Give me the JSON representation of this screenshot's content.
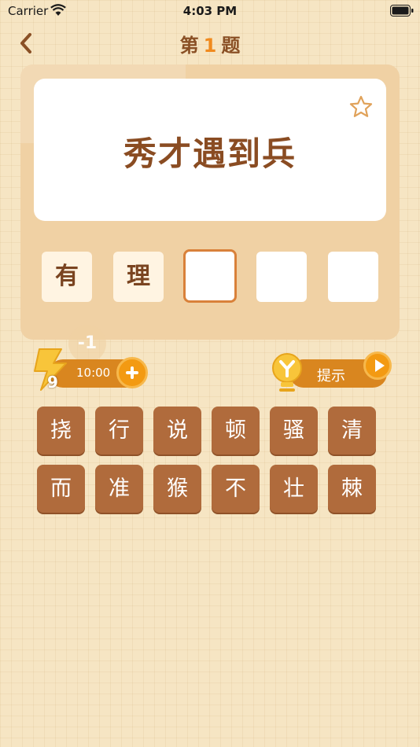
{
  "status": {
    "carrier": "Carrier",
    "time": "4:03 PM"
  },
  "header": {
    "title_prefix": "第",
    "question_number": "1",
    "title_suffix": "题"
  },
  "question": {
    "text": "秀才遇到兵"
  },
  "answer_slots": [
    "有",
    "理",
    "",
    "",
    ""
  ],
  "energy": {
    "penalty": "-1",
    "timer": "10:00",
    "count": "9"
  },
  "hint": {
    "label": "提示"
  },
  "letters": [
    "挠",
    "行",
    "说",
    "顿",
    "骚",
    "清",
    "而",
    "准",
    "猴",
    "不",
    "壮",
    "棘"
  ],
  "colors": {
    "accent": "#f08a1e",
    "tile": "#b06b3c",
    "title": "#8a5025",
    "board": "#f0d1a4"
  }
}
